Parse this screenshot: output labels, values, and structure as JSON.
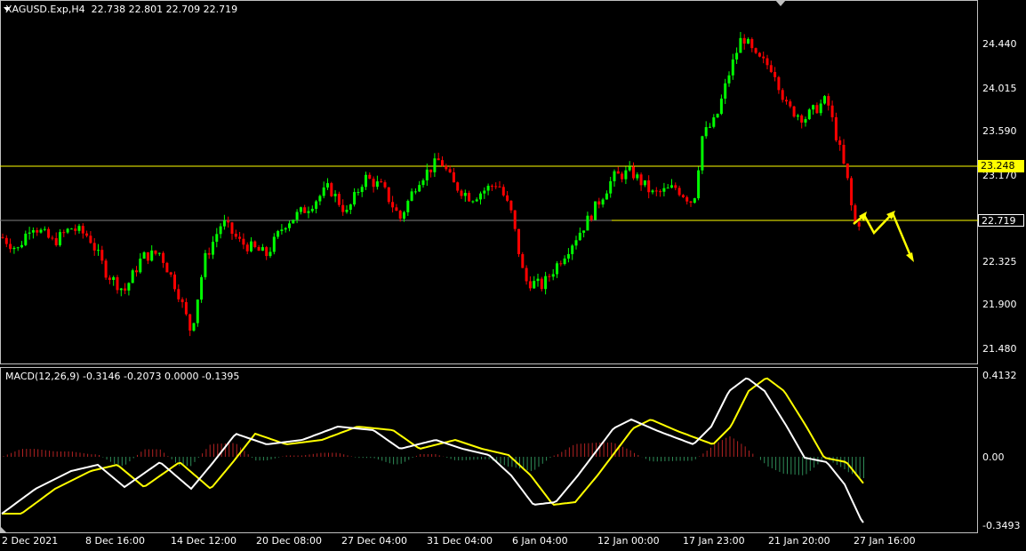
{
  "header": {
    "symbol": "XAGUSD.Exp,H4",
    "open": "22.738",
    "high": "22.801",
    "low": "22.709",
    "close": "22.719"
  },
  "macd": {
    "label": "MACD(12,26,9) -0.3146 -0.2073 0.0000 -0.1395",
    "ticks": [
      "0.4132",
      "0.00",
      "-0.3493"
    ]
  },
  "price_axis": {
    "ticks": [
      "24.440",
      "24.015",
      "23.590",
      "23.170",
      "22.325",
      "21.900",
      "21.480"
    ],
    "level_tag": "23.248",
    "current_tag": "22.719"
  },
  "time_axis": {
    "ticks": [
      "2 Dec 2021",
      "8 Dec 16:00",
      "14 Dec 12:00",
      "20 Dec 08:00",
      "27 Dec 04:00",
      "31 Dec 04:00",
      "6 Jan 04:00",
      "12 Jan 00:00",
      "17 Jan 23:00",
      "21 Jan 20:00",
      "27 Jan 16:00"
    ]
  },
  "colors": {
    "background": "#000000",
    "bull": "#00ff00",
    "bear": "#ff0000",
    "level_line": "#ffff00",
    "macd_line": "#ffffff",
    "signal_line": "#ffff00",
    "hist_pos": "#b22222",
    "hist_neg": "#2e8b57",
    "forecast_arrow": "#ffff00"
  }
}
